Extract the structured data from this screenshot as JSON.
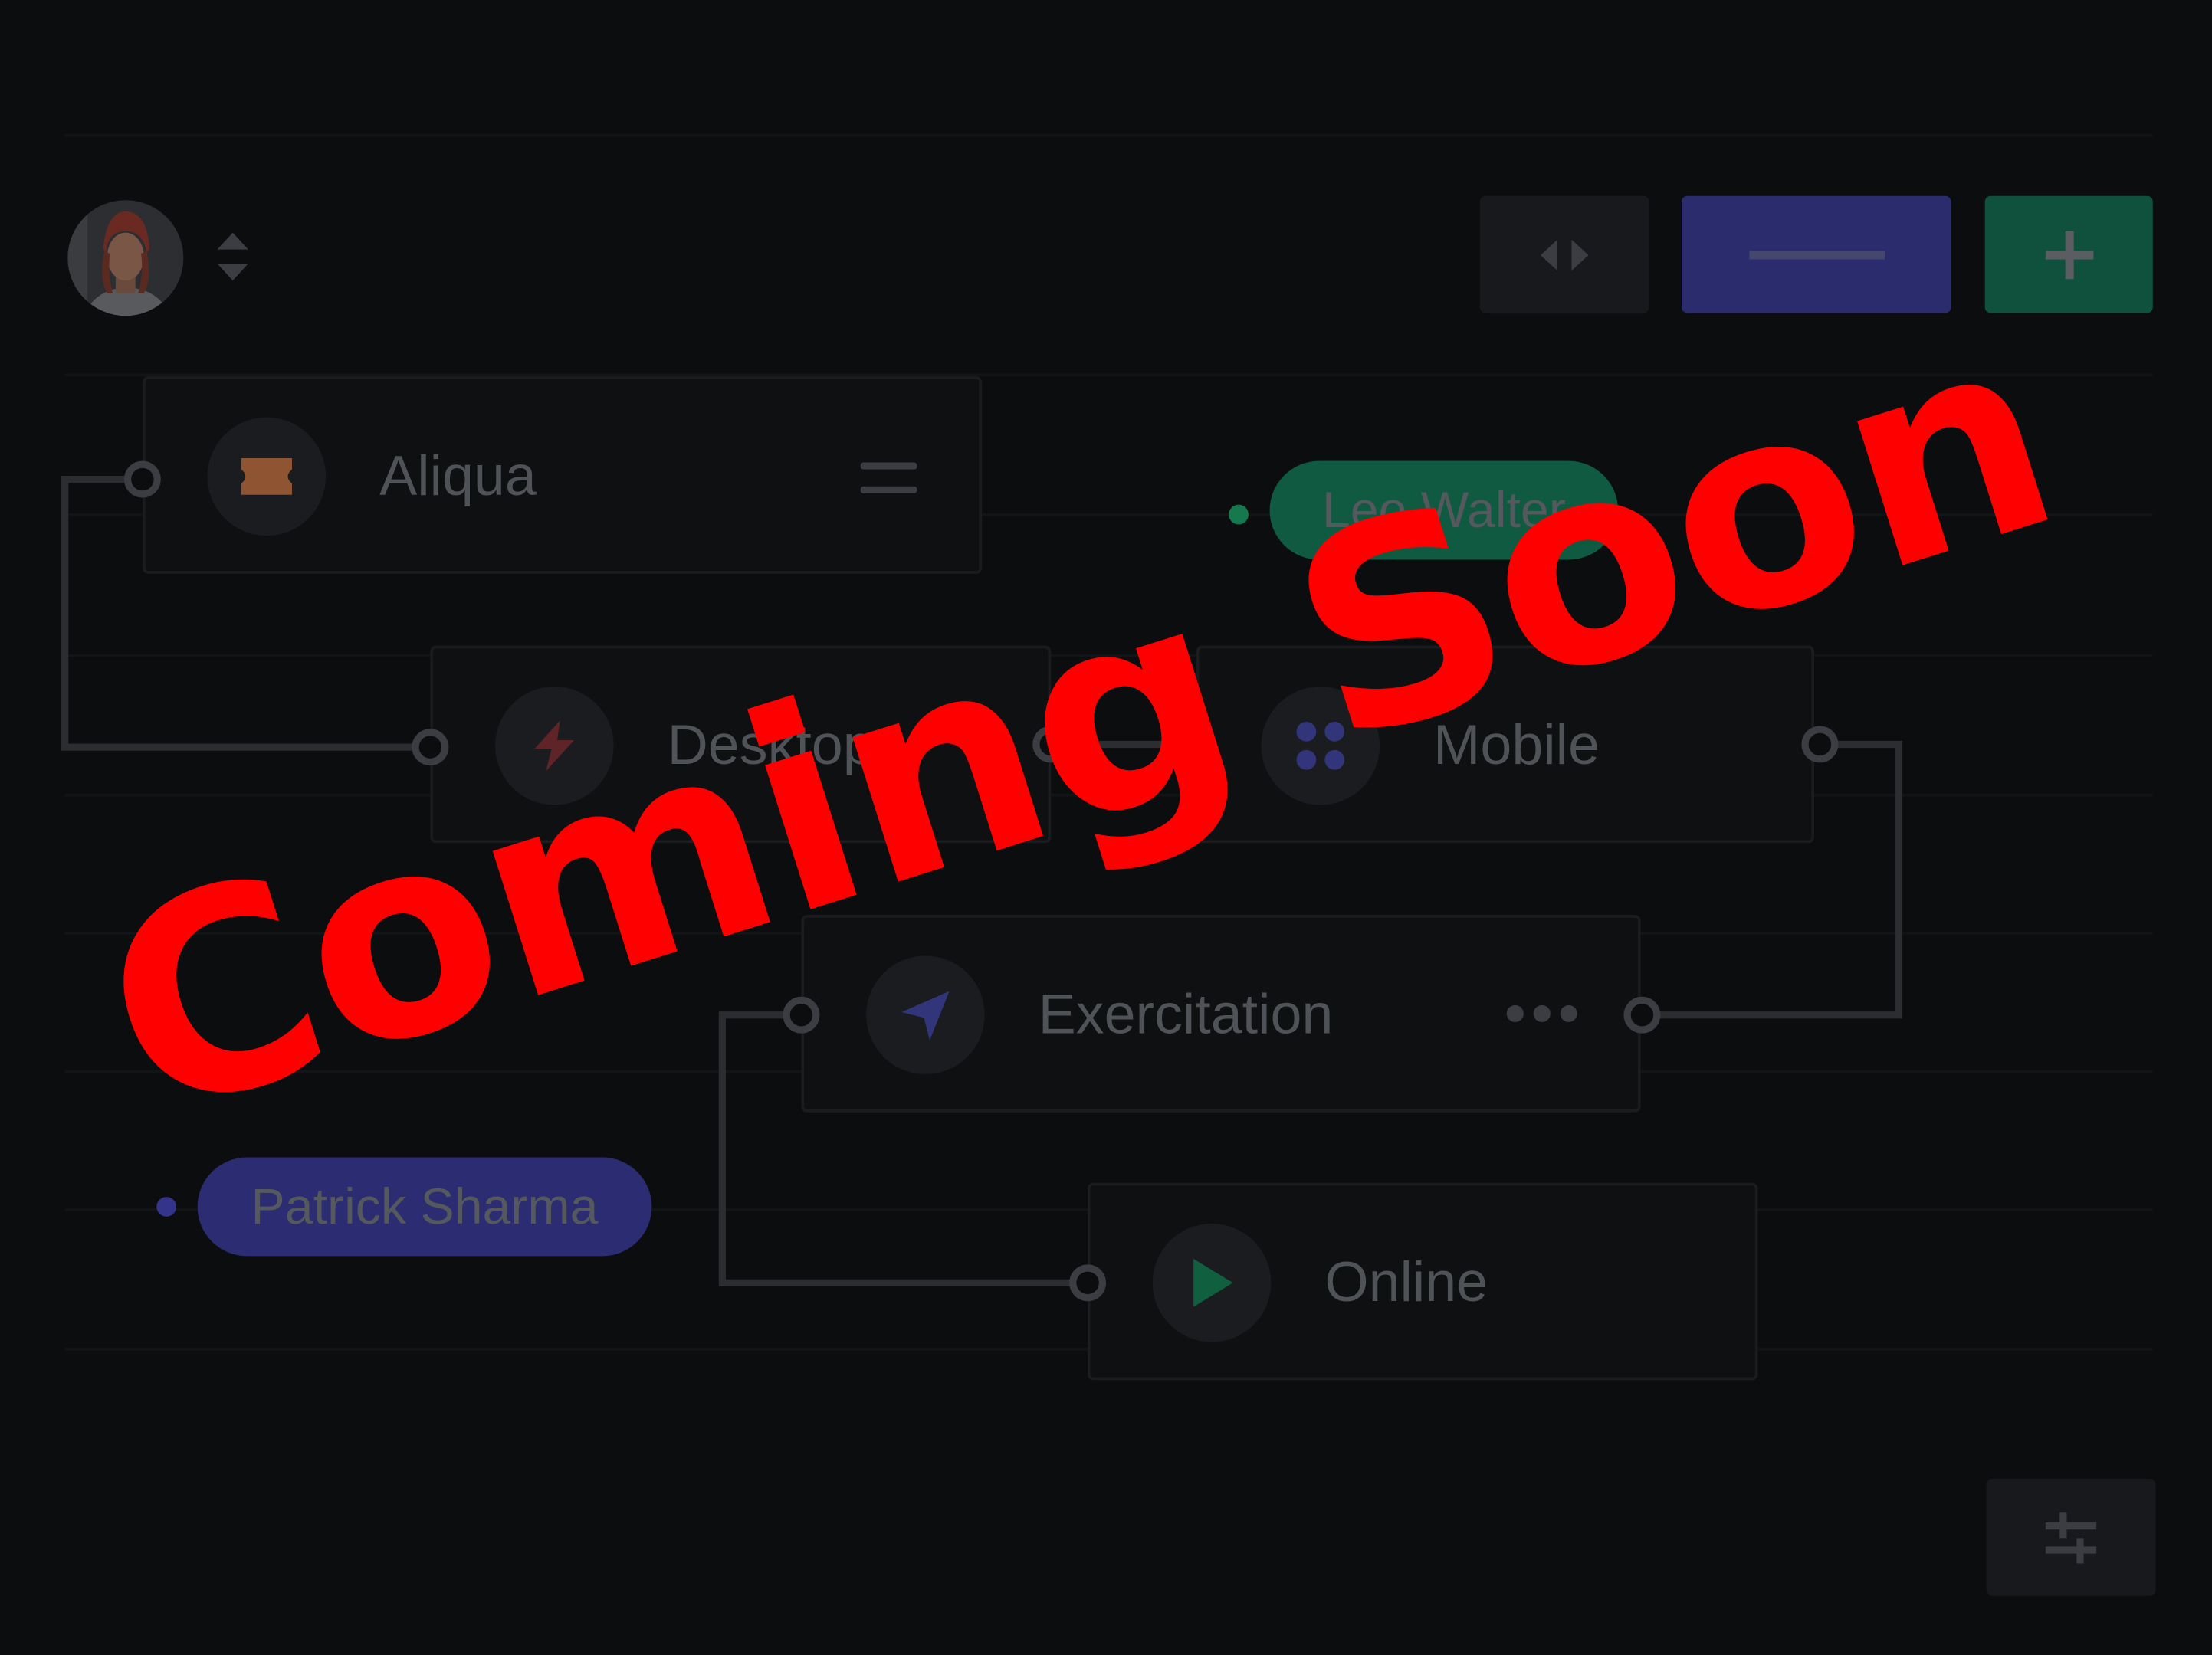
{
  "toolbar": {
    "avatar_icon": "user-avatar",
    "sort_icon": "sort-arrows-icon",
    "code_icon": "code-brackets-icon",
    "line_icon": "horizontal-line-icon",
    "add_icon": "plus-icon",
    "settings_icon": "sliders-icon"
  },
  "nodes": [
    {
      "label": "Aliqua",
      "icon": "ticket-icon",
      "icon_color": "#a65f38",
      "menu_icon": "hamburger-menu-icon"
    },
    {
      "label": "Desktop",
      "icon": "lightning-icon",
      "icon_color": "#6e2a2e"
    },
    {
      "label": "Mobile",
      "icon": "grid-dots-icon",
      "icon_color": "#3b3e8a"
    },
    {
      "label": "Exercitation",
      "icon": "navigation-arrow-icon",
      "icon_color": "#3b3e8a",
      "menu_icon": "more-dots-icon"
    },
    {
      "label": "Online",
      "icon": "play-icon",
      "icon_color": "#12744f"
    }
  ],
  "cursors": [
    {
      "name": "Leo Walter",
      "color": "#0f5a41",
      "dot_color": "#16784f"
    },
    {
      "name": "Patrick Sharma",
      "color": "#2b2c72",
      "dot_color": "#33348a"
    }
  ],
  "overlay": {
    "text": "Coming Soon",
    "color": "#ff0000"
  }
}
